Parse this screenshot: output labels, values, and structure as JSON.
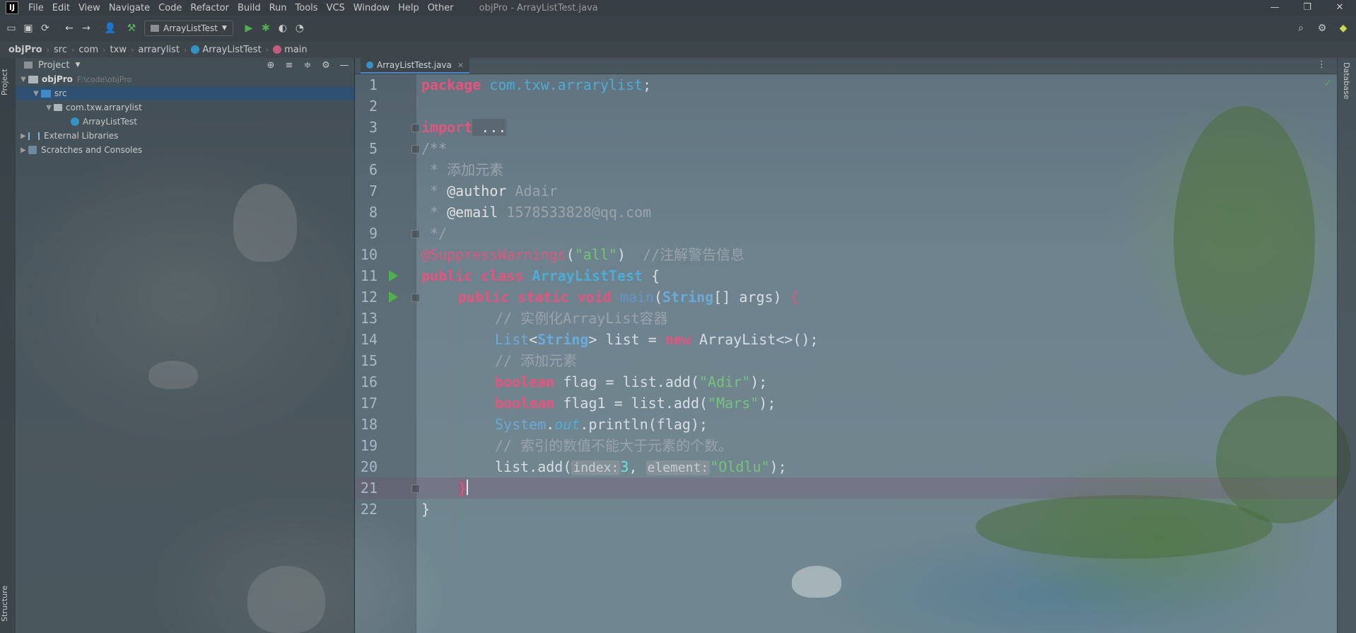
{
  "menubar": {
    "logo": "IJ",
    "items": [
      "File",
      "Edit",
      "View",
      "Navigate",
      "Code",
      "Refactor",
      "Build",
      "Run",
      "Tools",
      "VCS",
      "Window",
      "Help",
      "Other"
    ],
    "window_title": "objPro - ArrayListTest.java",
    "window_buttons": {
      "minimize": "—",
      "restore": "❐",
      "close": "✕"
    }
  },
  "toolbar": {
    "run_config": "ArrayListTest",
    "icons": [
      "open-folder-icon",
      "save-icon",
      "sync-icon",
      "back-icon",
      "forward-icon",
      "user-icon",
      "build-hammer-icon",
      "run-icon",
      "debug-icon",
      "coverage-icon",
      "profile-icon"
    ],
    "right_icons": [
      "search-icon",
      "gear-icon",
      "jetbrains-icon"
    ]
  },
  "breadcrumb": [
    "objPro",
    "src",
    "com",
    "txw",
    "arrarylist",
    "ArrayListTest",
    "main"
  ],
  "left_strip": {
    "project_tab": "Project",
    "structure_tab": "Structure"
  },
  "project_panel": {
    "title": "Project",
    "tree": [
      {
        "label": "objPro",
        "hint": "F:\\code\\objPro",
        "type": "module",
        "level": 0,
        "expanded": true,
        "selected": false,
        "bold": true
      },
      {
        "label": "src",
        "hint": "",
        "type": "src",
        "level": 1,
        "expanded": true,
        "selected": true,
        "bold": false
      },
      {
        "label": "com.txw.arrarylist",
        "hint": "",
        "type": "package",
        "level": 2,
        "expanded": true,
        "selected": false,
        "bold": false
      },
      {
        "label": "ArrayListTest",
        "hint": "",
        "type": "class",
        "level": 3,
        "expanded": false,
        "selected": false,
        "bold": false
      },
      {
        "label": "External Libraries",
        "hint": "",
        "type": "libraries",
        "level": 0,
        "expanded": false,
        "selected": false,
        "bold": false
      },
      {
        "label": "Scratches and Consoles",
        "hint": "",
        "type": "scratches",
        "level": 0,
        "expanded": false,
        "selected": false,
        "bold": false
      }
    ]
  },
  "editor": {
    "tab_label": "ArrayListTest.java",
    "current_line": 21,
    "lines": [
      {
        "n": "1",
        "run": false
      },
      {
        "n": "2",
        "run": false
      },
      {
        "n": "3",
        "run": false
      },
      {
        "n": "5",
        "run": false
      },
      {
        "n": "6",
        "run": false
      },
      {
        "n": "7",
        "run": false
      },
      {
        "n": "8",
        "run": false
      },
      {
        "n": "9",
        "run": false
      },
      {
        "n": "10",
        "run": false
      },
      {
        "n": "11",
        "run": true
      },
      {
        "n": "12",
        "run": true
      },
      {
        "n": "13",
        "run": false
      },
      {
        "n": "14",
        "run": false
      },
      {
        "n": "15",
        "run": false
      },
      {
        "n": "16",
        "run": false
      },
      {
        "n": "17",
        "run": false
      },
      {
        "n": "18",
        "run": false
      },
      {
        "n": "19",
        "run": false
      },
      {
        "n": "20",
        "run": false
      },
      {
        "n": "21",
        "run": false
      },
      {
        "n": "22",
        "run": false
      }
    ],
    "code": {
      "l1_kw": "package",
      "l1_pkg": "com.txw.arrarylist",
      "l1_end": ";",
      "l3_kw": "import",
      "l3_rest": " ...",
      "l5": "/**",
      "l6": " * 添加元素",
      "l7_a": " * ",
      "l7_tag": "@author",
      "l7_val": " Adair",
      "l8_a": " * ",
      "l8_tag": "@email",
      "l8_val": " 1578533828@qq.com",
      "l9": " */",
      "l10_ann": "@SuppressWarnings",
      "l10_open": "(",
      "l10_str": "\"all\"",
      "l10_close": ")",
      "l10_cmt": "  //注解警告信息",
      "l11_kw": "public class",
      "l11_cls": "ArrayListTest",
      "l11_end": " {",
      "l12_kw": "public static void",
      "l12_fn": "main",
      "l12_open": "(",
      "l12_typ": "String",
      "l12_rest": "[] args) ",
      "l12_brace": "{",
      "l13": "// 实例化ArrayList容器",
      "l14_typ": "List",
      "l14_lt": "<",
      "l14_typ2": "String",
      "l14_mid": "> list = ",
      "l14_kw": "new",
      "l14_rest": " ArrayList<>();",
      "l15": "// 添加元素",
      "l16_kw": "boolean",
      "l16_mid": " flag = list.add(",
      "l16_str": "\"Adir\"",
      "l16_end": ");",
      "l17_kw": "boolean",
      "l17_mid": " flag1 = list.add(",
      "l17_str": "\"Mars\"",
      "l17_end": ");",
      "l18_cls": "System",
      "l18_dot": ".",
      "l18_fld": "out",
      "l18_rest": ".println(flag);",
      "l19": "// 索引的数值不能大于元素的个数。",
      "l20_a": "list.add(",
      "l20_hint1": "index:",
      "l20_num": "3",
      "l20_comma": ",",
      "l20_hint2": "element:",
      "l20_str": "\"Oldlu\"",
      "l20_end": ");",
      "l21": "}",
      "l22": "}"
    }
  },
  "right_strip": {
    "database_tab": "Database"
  }
}
